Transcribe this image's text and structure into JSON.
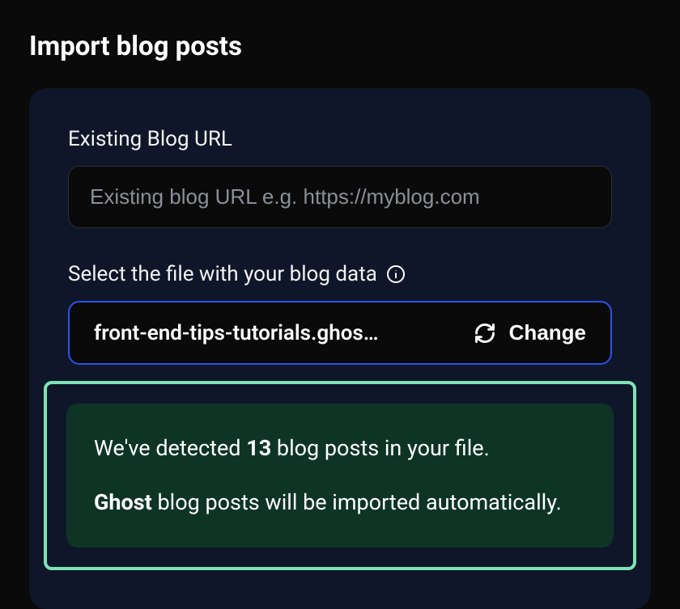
{
  "page": {
    "title": "Import blog posts"
  },
  "form": {
    "url_label": "Existing Blog URL",
    "url_placeholder": "Existing blog URL e.g. https://myblog.com",
    "file_label": "Select the file with your blog data",
    "file_name": "front-end-tips-tutorials.ghos…",
    "change_label": "Change"
  },
  "detection": {
    "pre_count": "We've detected ",
    "count": "13",
    "post_count": " blog posts in your file.",
    "platform": "Ghost",
    "platform_post": " blog posts will be imported automatically."
  }
}
